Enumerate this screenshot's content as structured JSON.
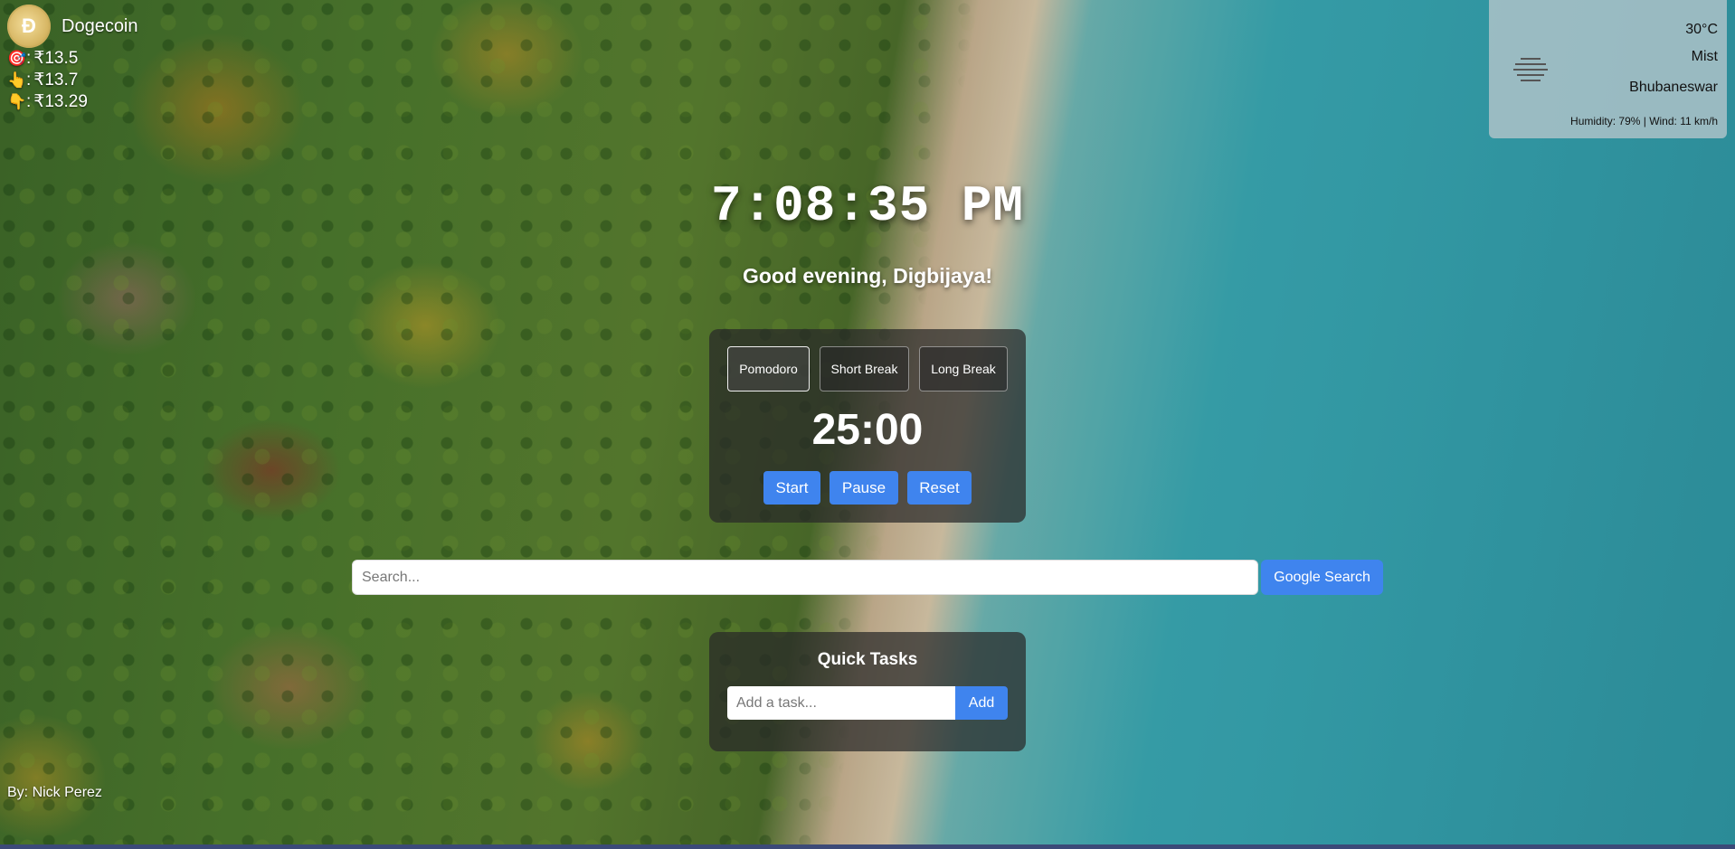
{
  "crypto": {
    "logo_letter": "Ð",
    "name": "Dogecoin",
    "prices": [
      {
        "icon": "target-icon",
        "glyph": "🎯",
        "sep": ":",
        "value": "₹13.5"
      },
      {
        "icon": "thumbs-up-icon",
        "glyph": "👆",
        "sep": ":",
        "value": "₹13.7"
      },
      {
        "icon": "thumbs-down-icon",
        "glyph": "👇",
        "sep": ":",
        "value": "₹13.29"
      }
    ]
  },
  "weather": {
    "icon": "mist-icon",
    "temperature": "30°C",
    "description": "Mist",
    "city": "Bhubaneswar",
    "details": "Humidity: 79% | Wind: 11 km/h"
  },
  "clock": {
    "time": "7:08:35 PM"
  },
  "greeting": "Good evening, Digbijaya!",
  "pomodoro": {
    "modes": [
      {
        "label": "Pomodoro",
        "active": true
      },
      {
        "label": "Short Break",
        "active": false
      },
      {
        "label": "Long Break",
        "active": false
      }
    ],
    "timer": "25:00",
    "buttons": {
      "start": "Start",
      "pause": "Pause",
      "reset": "Reset"
    }
  },
  "search": {
    "placeholder": "Search...",
    "button_label": "Google Search"
  },
  "tasks": {
    "title": "Quick Tasks",
    "placeholder": "Add a task...",
    "add_label": "Add"
  },
  "credit": "By: Nick Perez",
  "colors": {
    "accent": "#3f84ee",
    "panel": "rgba(40,40,40,0.72)"
  }
}
